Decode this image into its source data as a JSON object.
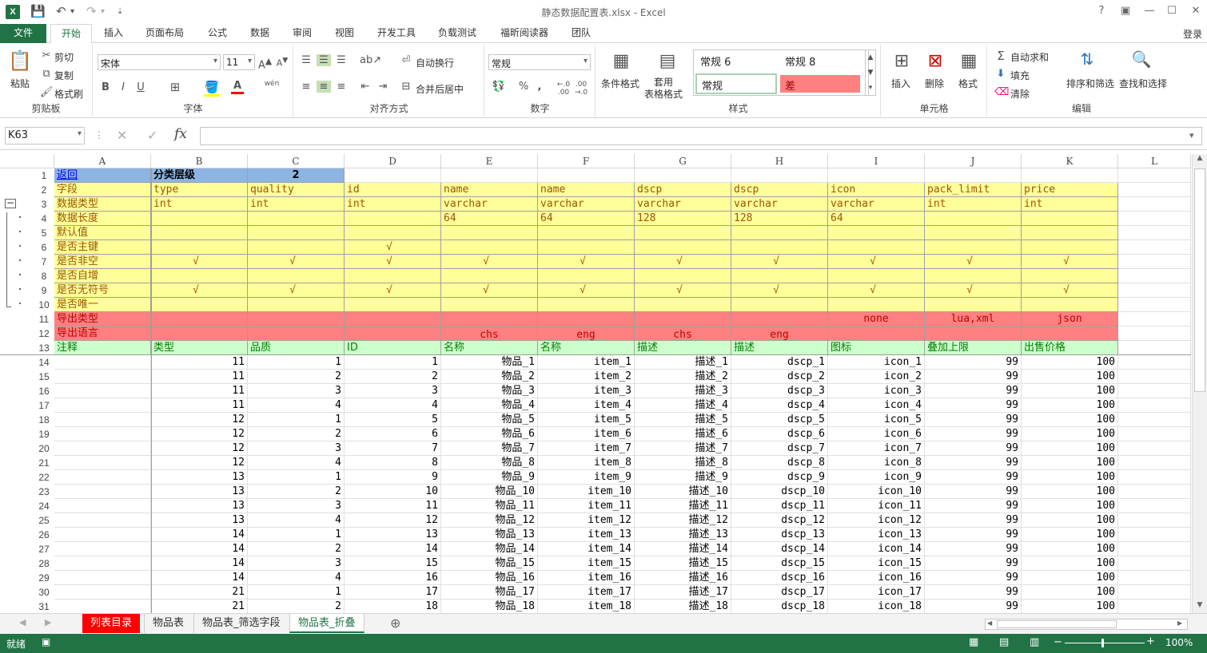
{
  "window": {
    "title": "静态数据配置表.xlsx - Excel",
    "login": "登录"
  },
  "ribbon_tabs": [
    "文件",
    "开始",
    "插入",
    "页面布局",
    "公式",
    "数据",
    "审阅",
    "视图",
    "开发工具",
    "负载测试",
    "福昕阅读器",
    "团队"
  ],
  "clipboard": {
    "paste": "粘贴",
    "cut": "剪切",
    "copy": "复制",
    "painter": "格式刷",
    "label": "剪贴板"
  },
  "font": {
    "name": "宋体",
    "size": "11",
    "label": "字体",
    "bold": "B",
    "italic": "I",
    "underline": "U",
    "wen": "wén"
  },
  "align": {
    "wrap": "自动换行",
    "merge": "合并后居中",
    "label": "对齐方式"
  },
  "number": {
    "format": "常规",
    "label": "数字",
    "percent": "%",
    "comma": ","
  },
  "styles": {
    "cond": "条件格式",
    "table": "套用\n表格格式",
    "s1": "常规 6",
    "s2": "常规 8",
    "s3": "常规",
    "s4": "差",
    "label": "样式"
  },
  "cells_group": {
    "insert": "插入",
    "delete": "删除",
    "format": "格式",
    "label": "单元格"
  },
  "edit": {
    "autosum": "自动求和",
    "fill": "填充",
    "clear": "清除",
    "sort": "排序和筛选",
    "find": "查找和选择",
    "label": "编辑"
  },
  "formula": {
    "namebox": "K63",
    "fx": "fx",
    "content": ""
  },
  "outline_levels": [
    "1",
    "2"
  ],
  "columns": [
    "A",
    "B",
    "C",
    "D",
    "E",
    "F",
    "G",
    "H",
    "I",
    "J",
    "K",
    "L"
  ],
  "header_rows": [
    {
      "n": "1",
      "cells": [
        "返回",
        "分类层级",
        "2",
        "",
        "",
        "",
        "",
        "",
        "",
        "",
        ""
      ]
    },
    {
      "n": "2",
      "cells": [
        "字段",
        "type",
        "quality",
        "id",
        "name",
        "name",
        "dscp",
        "dscp",
        "icon",
        "pack_limit",
        "price"
      ]
    },
    {
      "n": "3",
      "cells": [
        "数据类型",
        "int",
        "int",
        "int",
        "varchar",
        "varchar",
        "varchar",
        "varchar",
        "varchar",
        "int",
        "int"
      ]
    },
    {
      "n": "4",
      "cells": [
        "数据长度",
        "",
        "",
        "",
        "64",
        "64",
        "128",
        "128",
        "64",
        "",
        ""
      ]
    },
    {
      "n": "5",
      "cells": [
        "默认值",
        "",
        "",
        "",
        "",
        "",
        "",
        "",
        "",
        "",
        ""
      ]
    },
    {
      "n": "6",
      "cells": [
        "是否主键",
        "",
        "",
        "√",
        "",
        "",
        "",
        "",
        "",
        "",
        ""
      ]
    },
    {
      "n": "7",
      "cells": [
        "是否非空",
        "√",
        "√",
        "√",
        "√",
        "√",
        "√",
        "√",
        "√",
        "√",
        "√"
      ]
    },
    {
      "n": "8",
      "cells": [
        "是否自增",
        "",
        "",
        "",
        "",
        "",
        "",
        "",
        "",
        "",
        ""
      ]
    },
    {
      "n": "9",
      "cells": [
        "是否无符号",
        "√",
        "√",
        "√",
        "√",
        "√",
        "√",
        "√",
        "√",
        "√",
        "√"
      ]
    },
    {
      "n": "10",
      "cells": [
        "是否唯一",
        "",
        "",
        "",
        "",
        "",
        "",
        "",
        "",
        "",
        ""
      ]
    },
    {
      "n": "11",
      "cells": [
        "导出类型",
        "",
        "",
        "",
        "",
        "",
        "",
        "",
        "none",
        "lua,xml",
        "json"
      ]
    },
    {
      "n": "12",
      "cells": [
        "导出语言",
        "",
        "",
        "",
        "chs",
        "eng",
        "chs",
        "eng",
        "",
        "",
        ""
      ]
    },
    {
      "n": "13",
      "cells": [
        "注释",
        "类型",
        "品质",
        "ID",
        "名称",
        "名称",
        "描述",
        "描述",
        "图标",
        "叠加上限",
        "出售价格"
      ]
    }
  ],
  "data_rows": [
    {
      "n": "14",
      "cells": [
        "",
        "11",
        "1",
        "1",
        "物品_1",
        "item_1",
        "描述_1",
        "dscp_1",
        "icon_1",
        "99",
        "100"
      ]
    },
    {
      "n": "15",
      "cells": [
        "",
        "11",
        "2",
        "2",
        "物品_2",
        "item_2",
        "描述_2",
        "dscp_2",
        "icon_2",
        "99",
        "100"
      ]
    },
    {
      "n": "16",
      "cells": [
        "",
        "11",
        "3",
        "3",
        "物品_3",
        "item_3",
        "描述_3",
        "dscp_3",
        "icon_3",
        "99",
        "100"
      ]
    },
    {
      "n": "17",
      "cells": [
        "",
        "11",
        "4",
        "4",
        "物品_4",
        "item_4",
        "描述_4",
        "dscp_4",
        "icon_4",
        "99",
        "100"
      ]
    },
    {
      "n": "18",
      "cells": [
        "",
        "12",
        "1",
        "5",
        "物品_5",
        "item_5",
        "描述_5",
        "dscp_5",
        "icon_5",
        "99",
        "100"
      ]
    },
    {
      "n": "19",
      "cells": [
        "",
        "12",
        "2",
        "6",
        "物品_6",
        "item_6",
        "描述_6",
        "dscp_6",
        "icon_6",
        "99",
        "100"
      ]
    },
    {
      "n": "20",
      "cells": [
        "",
        "12",
        "3",
        "7",
        "物品_7",
        "item_7",
        "描述_7",
        "dscp_7",
        "icon_7",
        "99",
        "100"
      ]
    },
    {
      "n": "21",
      "cells": [
        "",
        "12",
        "4",
        "8",
        "物品_8",
        "item_8",
        "描述_8",
        "dscp_8",
        "icon_8",
        "99",
        "100"
      ]
    },
    {
      "n": "22",
      "cells": [
        "",
        "13",
        "1",
        "9",
        "物品_9",
        "item_9",
        "描述_9",
        "dscp_9",
        "icon_9",
        "99",
        "100"
      ]
    },
    {
      "n": "23",
      "cells": [
        "",
        "13",
        "2",
        "10",
        "物品_10",
        "item_10",
        "描述_10",
        "dscp_10",
        "icon_10",
        "99",
        "100"
      ]
    },
    {
      "n": "24",
      "cells": [
        "",
        "13",
        "3",
        "11",
        "物品_11",
        "item_11",
        "描述_11",
        "dscp_11",
        "icon_11",
        "99",
        "100"
      ]
    },
    {
      "n": "25",
      "cells": [
        "",
        "13",
        "4",
        "12",
        "物品_12",
        "item_12",
        "描述_12",
        "dscp_12",
        "icon_12",
        "99",
        "100"
      ]
    },
    {
      "n": "26",
      "cells": [
        "",
        "14",
        "1",
        "13",
        "物品_13",
        "item_13",
        "描述_13",
        "dscp_13",
        "icon_13",
        "99",
        "100"
      ]
    },
    {
      "n": "27",
      "cells": [
        "",
        "14",
        "2",
        "14",
        "物品_14",
        "item_14",
        "描述_14",
        "dscp_14",
        "icon_14",
        "99",
        "100"
      ]
    },
    {
      "n": "28",
      "cells": [
        "",
        "14",
        "3",
        "15",
        "物品_15",
        "item_15",
        "描述_15",
        "dscp_15",
        "icon_15",
        "99",
        "100"
      ]
    },
    {
      "n": "29",
      "cells": [
        "",
        "14",
        "4",
        "16",
        "物品_16",
        "item_16",
        "描述_16",
        "dscp_16",
        "icon_16",
        "99",
        "100"
      ]
    },
    {
      "n": "30",
      "cells": [
        "",
        "21",
        "1",
        "17",
        "物品_17",
        "item_17",
        "描述_17",
        "dscp_17",
        "icon_17",
        "99",
        "100"
      ]
    },
    {
      "n": "31",
      "cells": [
        "",
        "21",
        "2",
        "18",
        "物品_18",
        "item_18",
        "描述_18",
        "dscp_18",
        "icon_18",
        "99",
        "100"
      ]
    }
  ],
  "sheet_tabs": [
    "列表目录",
    "物品表",
    "物品表_筛选字段",
    "物品表_折叠"
  ],
  "status": {
    "ready": "就绪",
    "zoom": "100%"
  },
  "colors": {
    "accent": "#217346",
    "blue": "#8db4e2",
    "yellow": "#ffff99",
    "red": "#ff8080",
    "green": "#ccffcc",
    "tabred": "#ff0000"
  }
}
